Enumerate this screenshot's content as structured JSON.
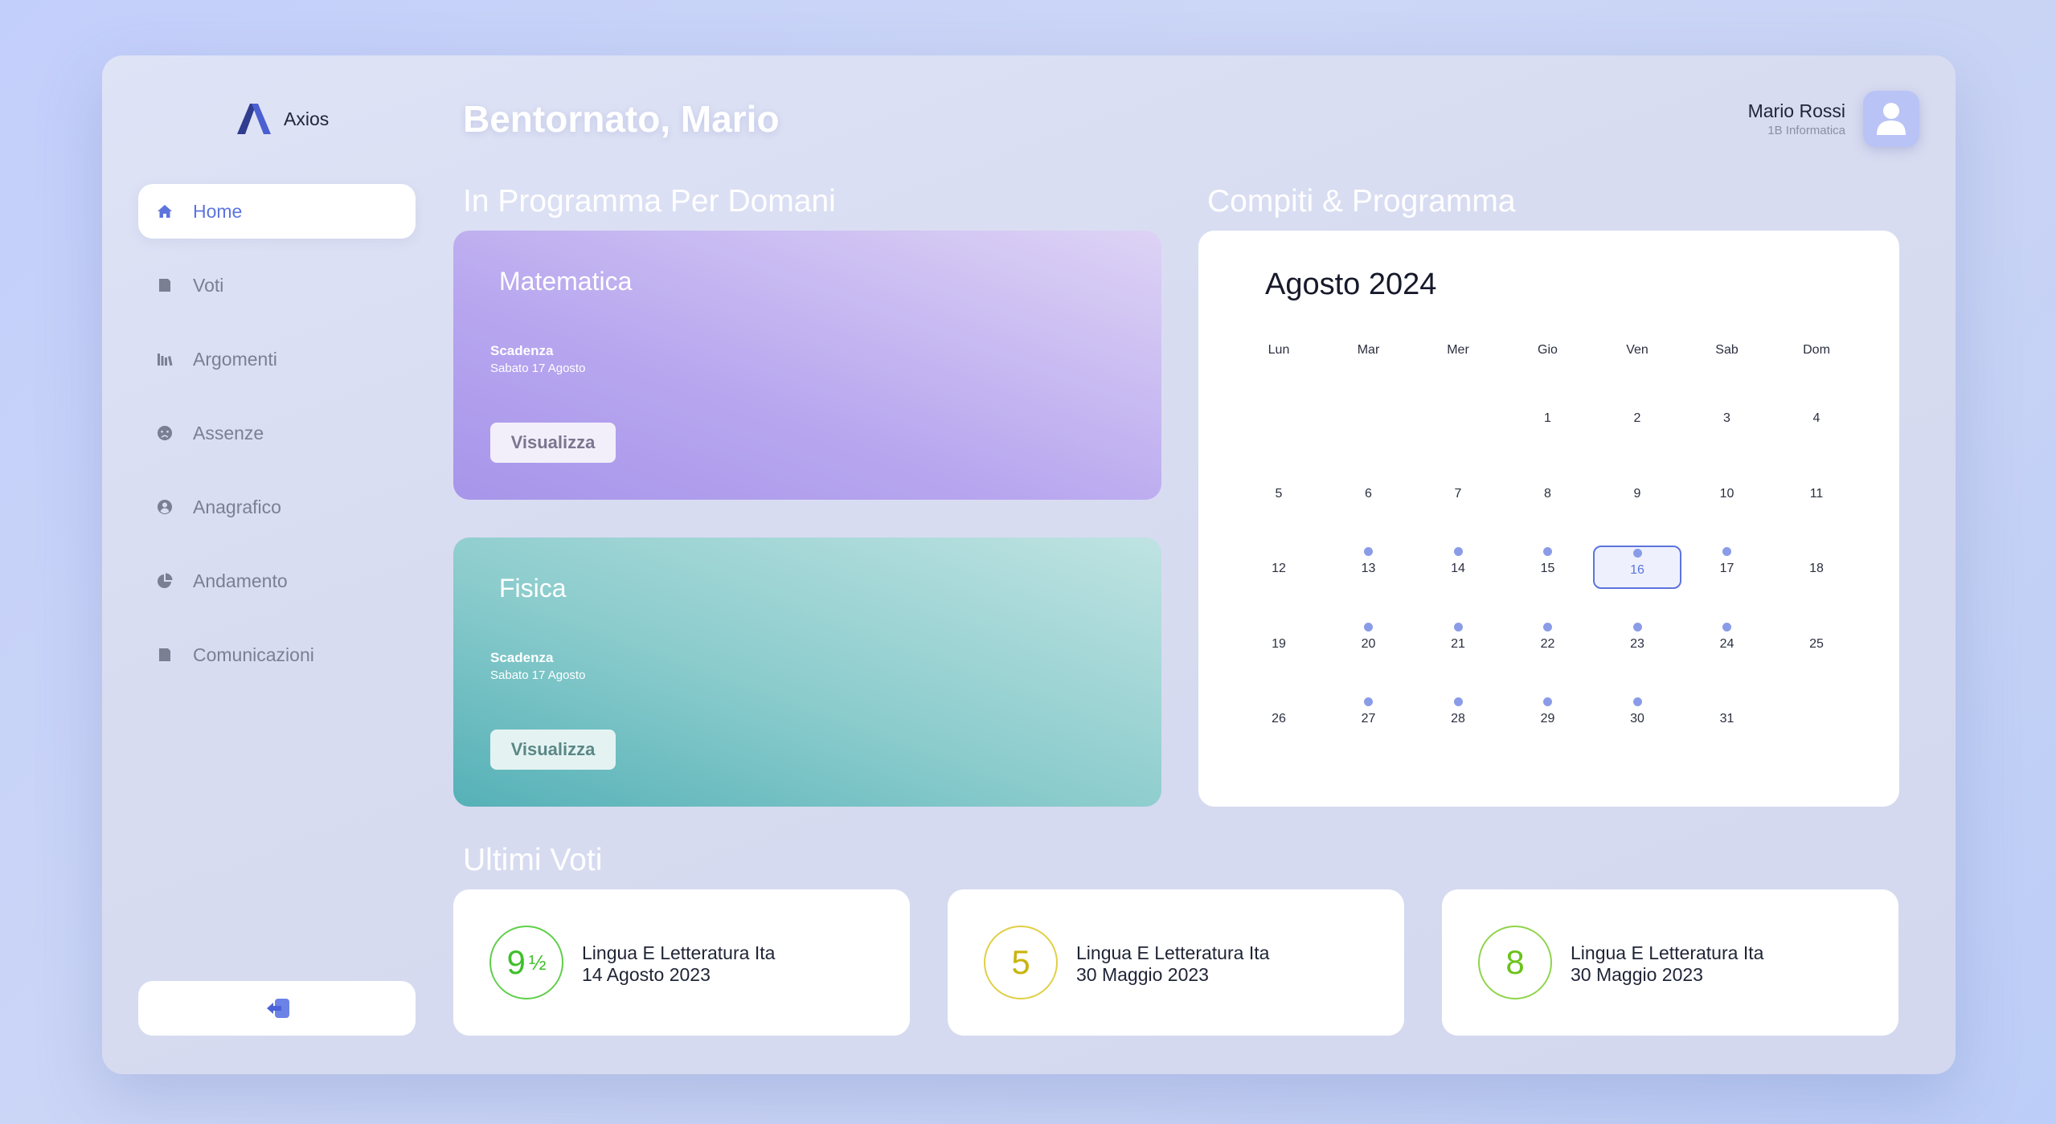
{
  "brand": {
    "name": "Axios"
  },
  "sidebar": {
    "items": [
      {
        "label": "Home",
        "icon": "home-icon",
        "active": true
      },
      {
        "label": "Voti",
        "icon": "document-icon",
        "active": false
      },
      {
        "label": "Argomenti",
        "icon": "books-icon",
        "active": false
      },
      {
        "label": "Assenze",
        "icon": "sad-face-icon",
        "active": false
      },
      {
        "label": "Anagrafico",
        "icon": "user-circle-icon",
        "active": false
      },
      {
        "label": "Andamento",
        "icon": "pie-chart-icon",
        "active": false
      },
      {
        "label": "Comunicazioni",
        "icon": "document-icon",
        "active": false
      }
    ],
    "logout_icon": "logout-icon"
  },
  "header": {
    "greeting": "Bentornato, Mario",
    "user_name": "Mario Rossi",
    "user_class": "1B Informatica"
  },
  "sections": {
    "tomorrow": "In Programma Per Domani",
    "homework": "Compiti & Programma",
    "grades": "Ultimi Voti"
  },
  "tasks": [
    {
      "subject": "Matematica",
      "due_label": "Scadenza",
      "due_date": "Sabato 17 Agosto",
      "button": "Visualizza"
    },
    {
      "subject": "Fisica",
      "due_label": "Scadenza",
      "due_date": "Sabato 17 Agosto",
      "button": "Visualizza"
    }
  ],
  "calendar": {
    "title": "Agosto 2024",
    "weekdays": [
      "Lun",
      "Mar",
      "Mer",
      "Gio",
      "Ven",
      "Sab",
      "Dom"
    ],
    "first_weekday_index": 3,
    "days_in_month": 31,
    "today": 16,
    "event_days": [
      13,
      14,
      15,
      16,
      17,
      20,
      21,
      22,
      23,
      24,
      27,
      28,
      29,
      30
    ]
  },
  "grades": [
    {
      "value": "9",
      "half": "½",
      "subject": "Lingua E Letteratura Ita",
      "date": "14 Agosto 2023",
      "color": "#3fbf2a",
      "border": "#5fcf4a"
    },
    {
      "value": "5",
      "half": "",
      "subject": "Lingua E Letteratura Ita",
      "date": "30 Maggio 2023",
      "color": "#c9b50e",
      "border": "#e0cf45"
    },
    {
      "value": "8",
      "half": "",
      "subject": "Lingua E Letteratura Ita",
      "date": "30 Maggio 2023",
      "color": "#6bc31a",
      "border": "#8fd44a"
    }
  ],
  "colors": {
    "accent": "#5d74dd",
    "event_dot": "#8a9ce8"
  }
}
